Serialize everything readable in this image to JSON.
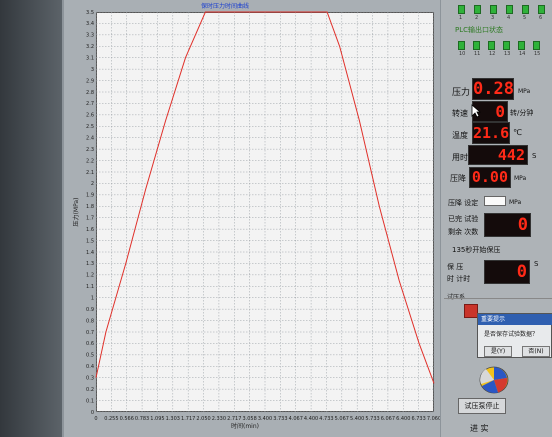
{
  "chart_data": {
    "type": "line",
    "title": "保时压力时间曲线",
    "xlabel": "时间(min)",
    "ylabel": "压力(MPa)",
    "ylim": [
      0,
      3.5
    ],
    "xlim": [
      0,
      6.8
    ],
    "yticks": [
      "0",
      "0.1",
      "0.2",
      "0.3",
      "0.4",
      "0.5",
      "0.6",
      "0.7",
      "0.8",
      "0.9",
      "1",
      "1.1",
      "1.2",
      "1.3",
      "1.4",
      "1.5",
      "1.6",
      "1.7",
      "1.8",
      "1.9",
      "2",
      "2.1",
      "2.2",
      "2.3",
      "2.4",
      "2.5",
      "2.6",
      "2.7",
      "2.8",
      "2.9",
      "3",
      "3.1",
      "3.2",
      "3.3",
      "3.4",
      "3.5"
    ],
    "xticks": [
      "0",
      "0.255",
      "0.566",
      "0.783",
      "1.095",
      "1.303",
      "1.717",
      "2.050",
      "2.330",
      "2.717",
      "3.058",
      "3.400",
      "3.733",
      "4.067",
      "4.400",
      "4.733",
      "5.067",
      "5.400",
      "5.733",
      "6.067",
      "6.400",
      "6.733",
      "7.060"
    ],
    "grid": true,
    "series": [
      {
        "color": "#e0302a",
        "x": [
          0,
          0.2,
          0.6,
          1.0,
          1.4,
          1.8,
          2.2,
          2.45,
          4.65,
          4.9,
          5.3,
          5.7,
          6.1,
          6.5,
          6.8
        ],
        "y": [
          0.3,
          0.7,
          1.3,
          1.95,
          2.55,
          3.1,
          3.5,
          3.5,
          3.5,
          3.2,
          2.55,
          1.8,
          1.15,
          0.6,
          0.25
        ]
      }
    ]
  },
  "plc": {
    "title": "PLC输出口状态",
    "indicators": [
      {
        "id": "1",
        "state": "on"
      },
      {
        "id": "2",
        "state": "on"
      },
      {
        "id": "3",
        "state": "on"
      },
      {
        "id": "4",
        "state": "on"
      },
      {
        "id": "5",
        "state": "on"
      },
      {
        "id": "6",
        "state": "on"
      },
      {
        "id": "10",
        "state": "on"
      },
      {
        "id": "11",
        "state": "on"
      },
      {
        "id": "12",
        "state": "on"
      },
      {
        "id": "13",
        "state": "on"
      },
      {
        "id": "14",
        "state": "on"
      },
      {
        "id": "15",
        "state": "on"
      }
    ]
  },
  "readouts": {
    "pressure": {
      "label": "压力",
      "value": "0.28",
      "unit": "MPa"
    },
    "speed": {
      "label": "转速",
      "value": "0",
      "unit": "转/分钟"
    },
    "temperature": {
      "label": "温度",
      "value": "21.6",
      "unit": "℃"
    },
    "elapsed": {
      "label": "用时",
      "value": "442",
      "unit": "S"
    },
    "drop": {
      "label": "压降",
      "value": "0.00",
      "unit": "MPa"
    }
  },
  "drop_setting": {
    "label": "压降 设定",
    "unit": "MPa"
  },
  "tests": {
    "done_label": "已完 试验",
    "remain_label": "剩余 次数",
    "value": "0"
  },
  "hold": {
    "title": "135秒开始保压",
    "row1": "保 压",
    "row2": "时 计时",
    "value": "0",
    "unit": "S"
  },
  "test_status_label": "试压系",
  "dialog": {
    "title": "重要提示",
    "message": "是否保存试验数据？",
    "yes": "是(Y)",
    "no": "否(N)"
  },
  "stop_button": "试压泵停止",
  "bottom_label": "进 实"
}
